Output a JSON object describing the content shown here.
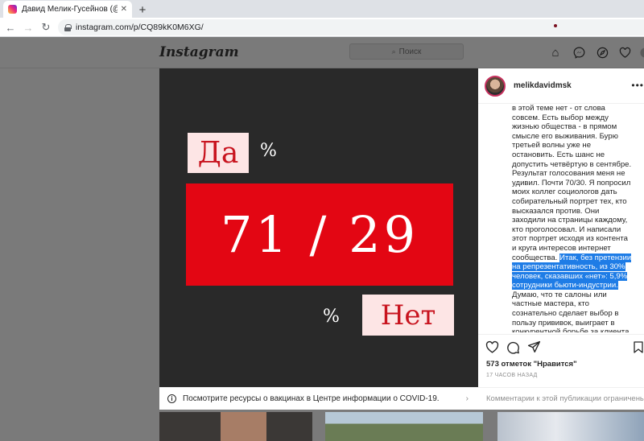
{
  "browser": {
    "tab_title": "Давид Мелик-Гусейнов (@melik",
    "tab_close": "✕",
    "new_tab": "+",
    "url": "instagram.com/p/CQ89kK0M6XG/"
  },
  "instagram": {
    "logo": "Instagram",
    "search_placeholder": "Поиск",
    "nav_icons": [
      "home-icon",
      "messenger-icon",
      "explore-icon",
      "heart-icon",
      "profile-icon"
    ]
  },
  "post": {
    "image": {
      "da": "Да",
      "pct_top": "%",
      "ratio": "71 / 29",
      "pct_bottom": "%",
      "net": "Нет",
      "colors": {
        "background": "#292929",
        "red": "#e30613",
        "pink": "#fde5e5"
      }
    },
    "covid_notice": "Посмотрите ресурсы о вакцинах в Центре информации о COVID-19.",
    "username": "melikdavidmsk",
    "caption_before": "в этой теме нет - от слова совсем. Есть выбор между жизнью общества - в прямом смысле его выживания. Бурю третьей волны уже не остановить. Есть шанс не допустить четвёртую в сентябре. Результат голосования меня не удивил. Почти 70/30. Я попросил моих коллег социологов дать собирательный портрет тех, кто высказался против. Они заходили на страницы каждому, кто проголосовал. И написали этот портрет исходя из контента и круга интересов интернет сообщества.",
    "caption_highlight": "Итак, без претензии на репрезентативность, из 30% человек, сказавших «нет»: 5,9% сотрудники бьюти-индустрии.",
    "caption_after": "Думаю, что те салоны или частные мастера, кто сознательно сделает выбор в пользу прививок, выиграет в конкурентной борьбе за клиента. Да и шансов жить, у тех и других будет больше.",
    "likes": "573 отметок \"Нравится\"",
    "time": "17 ЧАСОВ НАЗАД",
    "comments_disabled": "Комментарии к этой публикации ограничены"
  }
}
